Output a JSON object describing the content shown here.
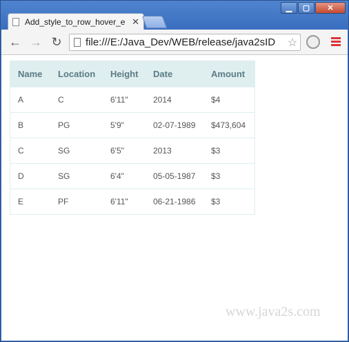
{
  "browser": {
    "tab_title": "Add_style_to_row_hover_e",
    "url": "file:///E:/Java_Dev/WEB/release/java2sID"
  },
  "table": {
    "headers": [
      "Name",
      "Location",
      "Height",
      "Date",
      "Amount"
    ],
    "rows": [
      [
        "A",
        "C",
        "6'11\"",
        "2014",
        "$4"
      ],
      [
        "B",
        "PG",
        "5'9\"",
        "02-07-1989",
        "$473,604"
      ],
      [
        "C",
        "SG",
        "6'5\"",
        "2013",
        "$3"
      ],
      [
        "D",
        "SG",
        "6'4\"",
        "05-05-1987",
        "$3"
      ],
      [
        "E",
        "PF",
        "6'11\"",
        "06-21-1986",
        "$3"
      ]
    ]
  },
  "watermark": "www.java2s.com"
}
